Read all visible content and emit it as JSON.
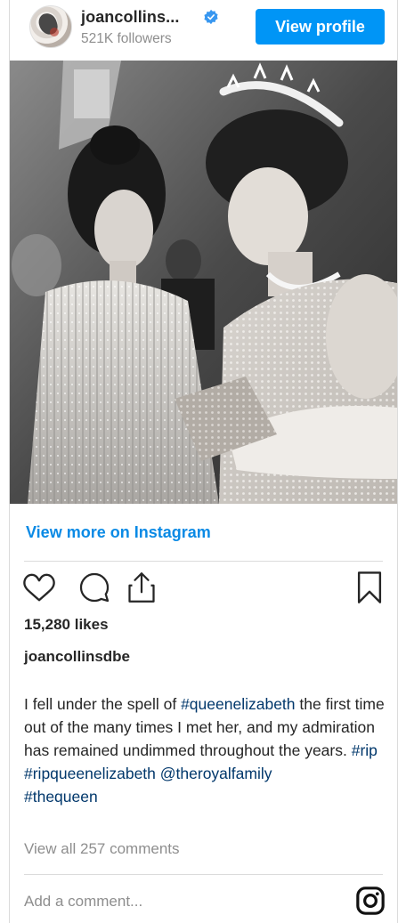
{
  "header": {
    "username": "joancollins...",
    "followers": "521K followers",
    "view_profile_label": "View profile"
  },
  "post": {
    "view_more_label": "View more on Instagram",
    "likes": "15,280 likes",
    "owner": "joancollinsdbe",
    "caption": {
      "text_1": "I fell under the spell of ",
      "tag_1": "#queenelizabeth",
      "text_2": " the first time out of the many times I met her, and my admiration has remained undimmed throughout the years. ",
      "tag_2": "#rip",
      "tag_3": "#ripqueenelizabeth",
      "tag_4": "@theroyalfamily",
      "tag_5": "#thequeen"
    },
    "view_comments": "View all 257 comments",
    "add_comment_placeholder": "Add a comment..."
  },
  "colors": {
    "accent": "#0095f6",
    "link": "#00376b",
    "muted": "#8e8e8e",
    "verified": "#3897f0"
  },
  "icons": [
    "verified-badge-icon",
    "heart-icon",
    "comment-icon",
    "share-icon",
    "bookmark-icon",
    "instagram-icon"
  ]
}
